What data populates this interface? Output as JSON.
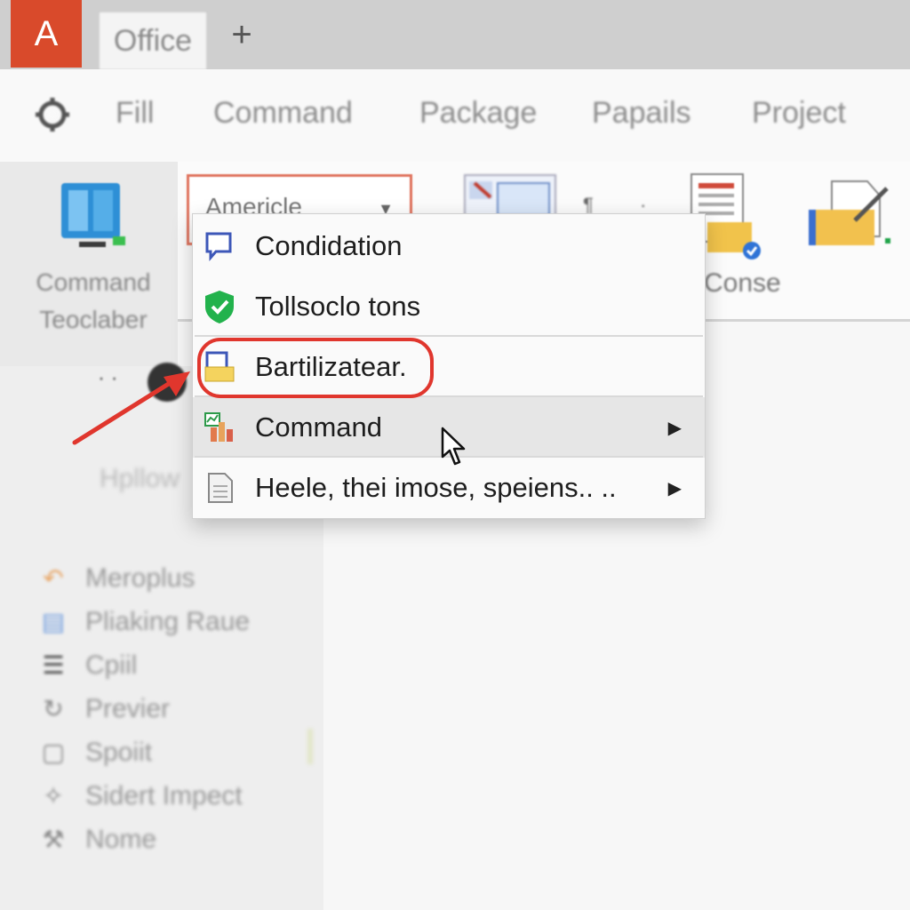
{
  "titlebar": {
    "app_badge": "A",
    "tab_label": "Office",
    "new_tab": "+"
  },
  "menubar": {
    "items": [
      "Fill",
      "Command",
      "Package",
      "Papails",
      "Project"
    ]
  },
  "ribbon": {
    "big_command_label": "Command Teoclaber",
    "dropdown_value": "Americle",
    "small_marks": [
      "¶",
      "·"
    ],
    "doc_label": "Conse"
  },
  "context_menu": {
    "items": [
      {
        "label": "Condidation",
        "icon": "speech-bubble-icon",
        "submenu": false
      },
      {
        "label": "Tollsoclo tons",
        "icon": "green-shield-icon",
        "submenu": false
      },
      {
        "label": "Bartilizatear.",
        "icon": "folder-document-icon",
        "submenu": false,
        "highlighted": true
      },
      {
        "label": "Command",
        "icon": "chart-icon",
        "submenu": true,
        "hovered": true
      },
      {
        "label": "Heele, thei imose, speiens.. ..",
        "icon": "document-icon",
        "submenu": true
      }
    ]
  },
  "left_pane": {
    "dots": "· ·",
    "faint_label": "Hpllow",
    "items": [
      {
        "label": "Meroplus",
        "icon": "orange-curve-icon"
      },
      {
        "label": "Pliaking Raue",
        "icon": "blue-card-icon"
      },
      {
        "label": "Cpiil",
        "icon": "stack-icon"
      },
      {
        "label": "Previer",
        "icon": "refresh-icon"
      },
      {
        "label": "Spoiit",
        "icon": "frame-icon"
      },
      {
        "label": "Sidert Impect",
        "icon": "sparkle-icon"
      },
      {
        "label": "Nome",
        "icon": "tools-icon"
      }
    ]
  },
  "colors": {
    "accent_red": "#e0362d",
    "app_badge": "#d94a2b",
    "shield_green": "#22b24c"
  }
}
